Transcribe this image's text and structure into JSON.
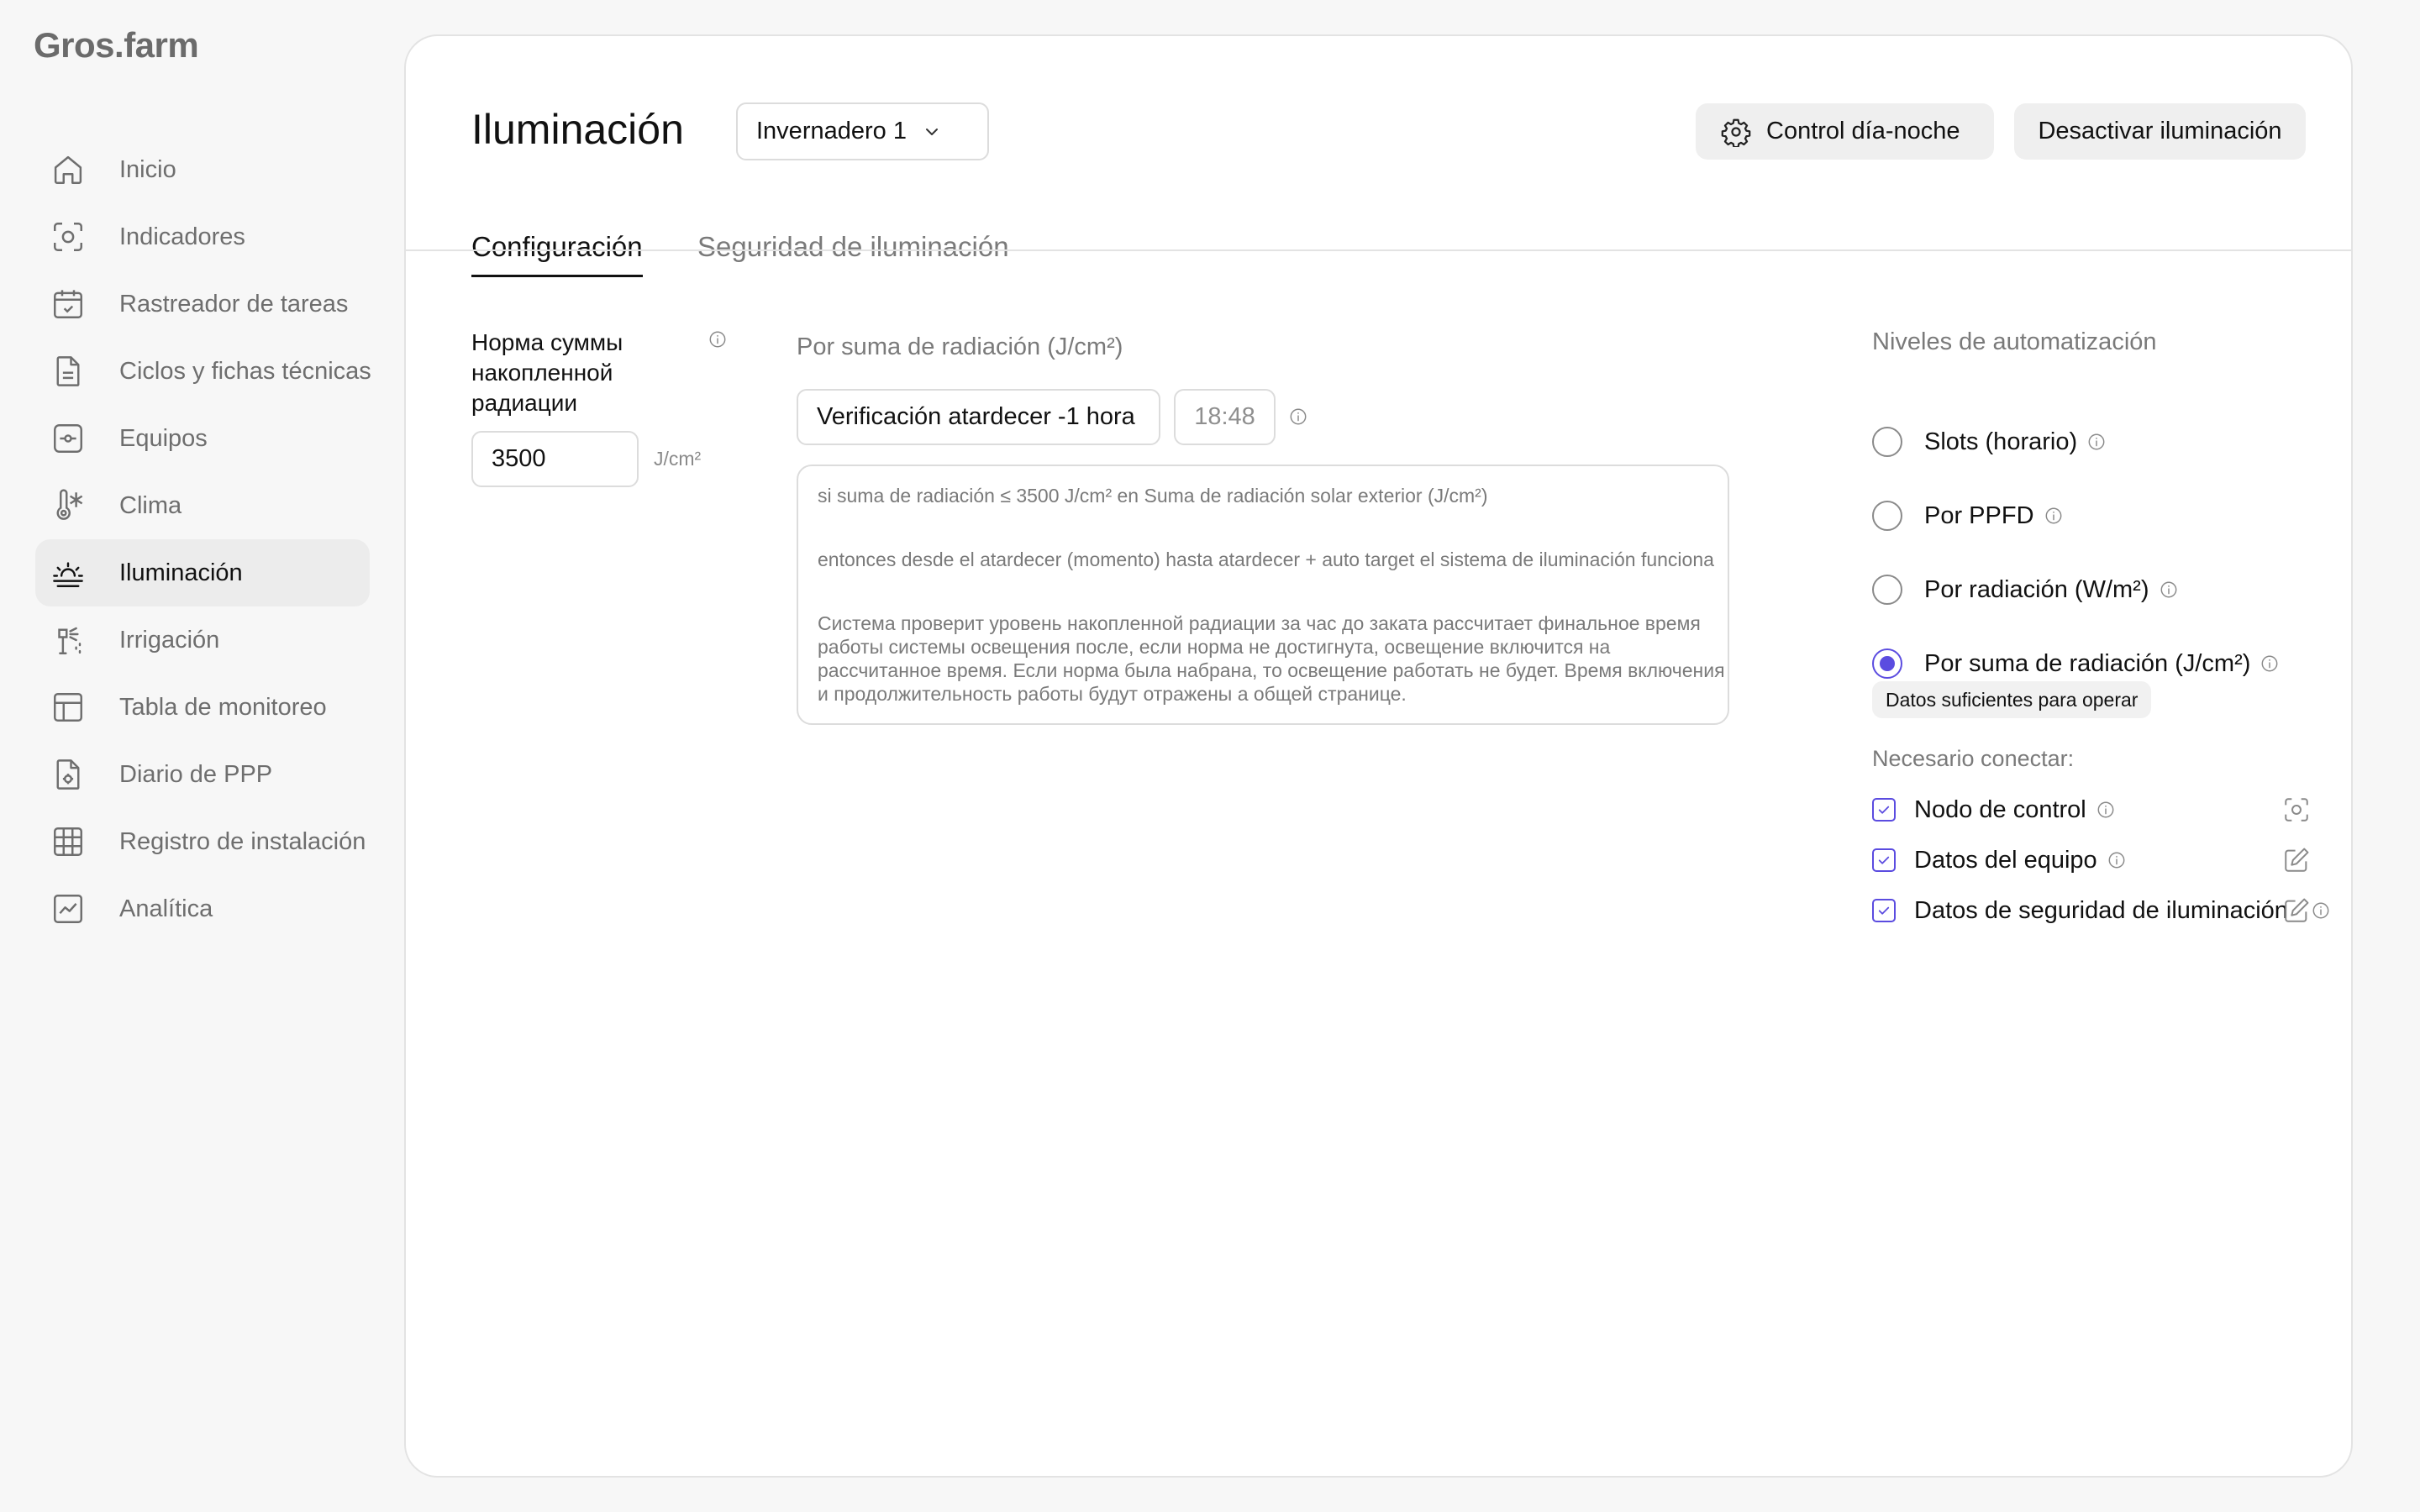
{
  "app": {
    "logo": "Gros.farm"
  },
  "sidebar": {
    "items": [
      {
        "label": "Inicio",
        "icon": "home-icon",
        "active": false
      },
      {
        "label": "Indicadores",
        "icon": "sensor-icon",
        "active": false
      },
      {
        "label": "Rastreador de tareas",
        "icon": "calendar-check-icon",
        "active": false
      },
      {
        "label": "Ciclos y fichas técnicas",
        "icon": "document-icon",
        "active": false
      },
      {
        "label": "Equipos",
        "icon": "equipment-icon",
        "active": false
      },
      {
        "label": "Clima",
        "icon": "thermometer-snow-icon",
        "active": false
      },
      {
        "label": "Iluminación",
        "icon": "sunrise-icon",
        "active": true
      },
      {
        "label": "Irrigación",
        "icon": "sprinkler-icon",
        "active": false
      },
      {
        "label": "Tabla de monitoreo",
        "icon": "table-icon",
        "active": false
      },
      {
        "label": "Diario de PPP",
        "icon": "document-gear-icon",
        "active": false
      },
      {
        "label": "Registro de instalación",
        "icon": "grid-icon",
        "active": false
      },
      {
        "label": "Analítica",
        "icon": "chart-line-icon",
        "active": false
      }
    ]
  },
  "header": {
    "title": "Iluminación",
    "greenhouse_select": "Invernadero 1",
    "day_night_button": "Control día-noche",
    "disable_button": "Desactivar iluminación"
  },
  "tabs": [
    {
      "label": "Configuración",
      "active": true
    },
    {
      "label": "Seguridad de iluminación",
      "active": false
    }
  ],
  "norm": {
    "label": "Норма суммы накопленной радиации",
    "value": "3500",
    "unit": "J/cm²"
  },
  "rule": {
    "title": "Por suma de radiación (J/cm²)",
    "check_select": "Verificación atardecer -1 hora",
    "time": "18:48",
    "line1": "si suma de radiación ≤ 3500 J/cm² en Suma de radiación solar exterior (J/cm²)",
    "line2": "entonces desde el atardecer (momento) hasta atardecer + auto target el sistema de iluminación funciona",
    "description": "Система проверит  уровень накопленной радиации за час до заката рассчитает финальное время работы системы освещения после, если норма не достигнута, освещение включится на рассчитанное время. Если норма была набрана, то освещение работать не будет. Время включения и продолжительность работы будут отражены а общей странице."
  },
  "automation": {
    "title": "Niveles de automatización",
    "options": [
      {
        "label": "Slots (horario)",
        "selected": false
      },
      {
        "label": "Por PPFD",
        "selected": false
      },
      {
        "label": "Por radiación (W/m²)",
        "selected": false
      },
      {
        "label": "Por suma de radiación (J/cm²)",
        "selected": true
      }
    ],
    "status_badge": "Datos suficientes para operar",
    "connect_title": "Necesario conectar:",
    "requirements": [
      {
        "label": "Nodo de control",
        "checked": true,
        "action_icon": "sensor-icon"
      },
      {
        "label": "Datos del equipo",
        "checked": true,
        "action_icon": "edit-icon"
      },
      {
        "label": "Datos de seguridad de iluminación",
        "checked": true,
        "action_icon": "edit-icon"
      }
    ]
  },
  "colors": {
    "accent": "#5b4ce0",
    "active_nav_bg": "#ececec",
    "button_bg": "#efefef"
  }
}
